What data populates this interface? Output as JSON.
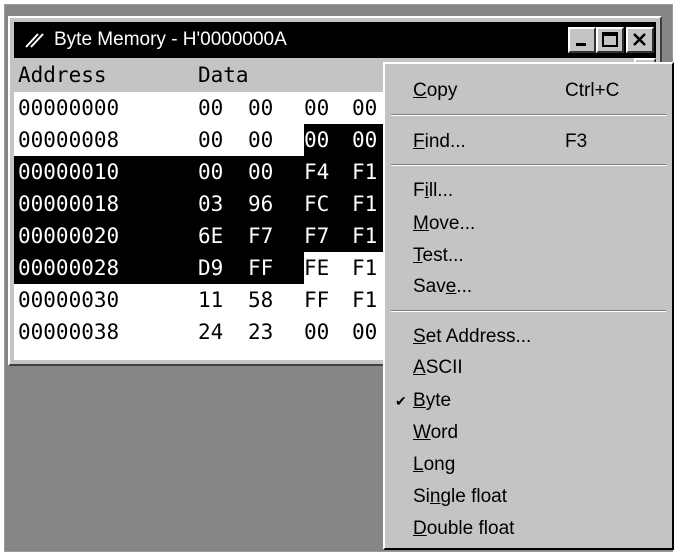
{
  "window": {
    "title": "Byte Memory - H'0000000A"
  },
  "header": {
    "address_label": "Address",
    "data_label": "Data"
  },
  "rows": [
    {
      "address": "00000000",
      "bytes": [
        "00",
        "00",
        "00",
        "00"
      ]
    },
    {
      "address": "00000008",
      "bytes": [
        "00",
        "00",
        "00",
        "00"
      ]
    },
    {
      "address": "00000010",
      "bytes": [
        "00",
        "00",
        "F4",
        "F1"
      ]
    },
    {
      "address": "00000018",
      "bytes": [
        "03",
        "96",
        "FC",
        "F1"
      ]
    },
    {
      "address": "00000020",
      "bytes": [
        "6E",
        "F7",
        "F7",
        "F1"
      ]
    },
    {
      "address": "00000028",
      "bytes": [
        "D9",
        "FF",
        "FE",
        "F1"
      ]
    },
    {
      "address": "00000030",
      "bytes": [
        "11",
        "58",
        "FF",
        "F1"
      ]
    },
    {
      "address": "00000038",
      "bytes": [
        "24",
        "23",
        "00",
        "00"
      ]
    }
  ],
  "context_menu": {
    "copy": {
      "pre": "",
      "key": "C",
      "post": "opy",
      "accel": "Ctrl+C"
    },
    "find": {
      "pre": "",
      "key": "F",
      "post": "ind...",
      "accel": "F3"
    },
    "fill": {
      "pre": "F",
      "key": "i",
      "post": "ll..."
    },
    "move": {
      "pre": "",
      "key": "M",
      "post": "ove..."
    },
    "test": {
      "pre": "",
      "key": "T",
      "post": "est..."
    },
    "save": {
      "pre": "Sav",
      "key": "e",
      "post": "..."
    },
    "set_address": {
      "pre": "",
      "key": "S",
      "post": "et Address..."
    },
    "ascii": {
      "pre": "",
      "key": "A",
      "post": "SCII"
    },
    "byte": {
      "pre": "",
      "key": "B",
      "post": "yte",
      "check": "✔"
    },
    "word": {
      "pre": "",
      "key": "W",
      "post": "ord"
    },
    "long": {
      "pre": "",
      "key": "L",
      "post": "ong"
    },
    "single_float": {
      "pre": "Si",
      "key": "n",
      "post": "gle float"
    },
    "double_float": {
      "pre": "",
      "key": "D",
      "post": "ouble float"
    }
  },
  "colors": {
    "title_bar": "#000000",
    "selection": "#000000",
    "menu_bg": "#c4c4c4",
    "workspace": "#868686"
  }
}
